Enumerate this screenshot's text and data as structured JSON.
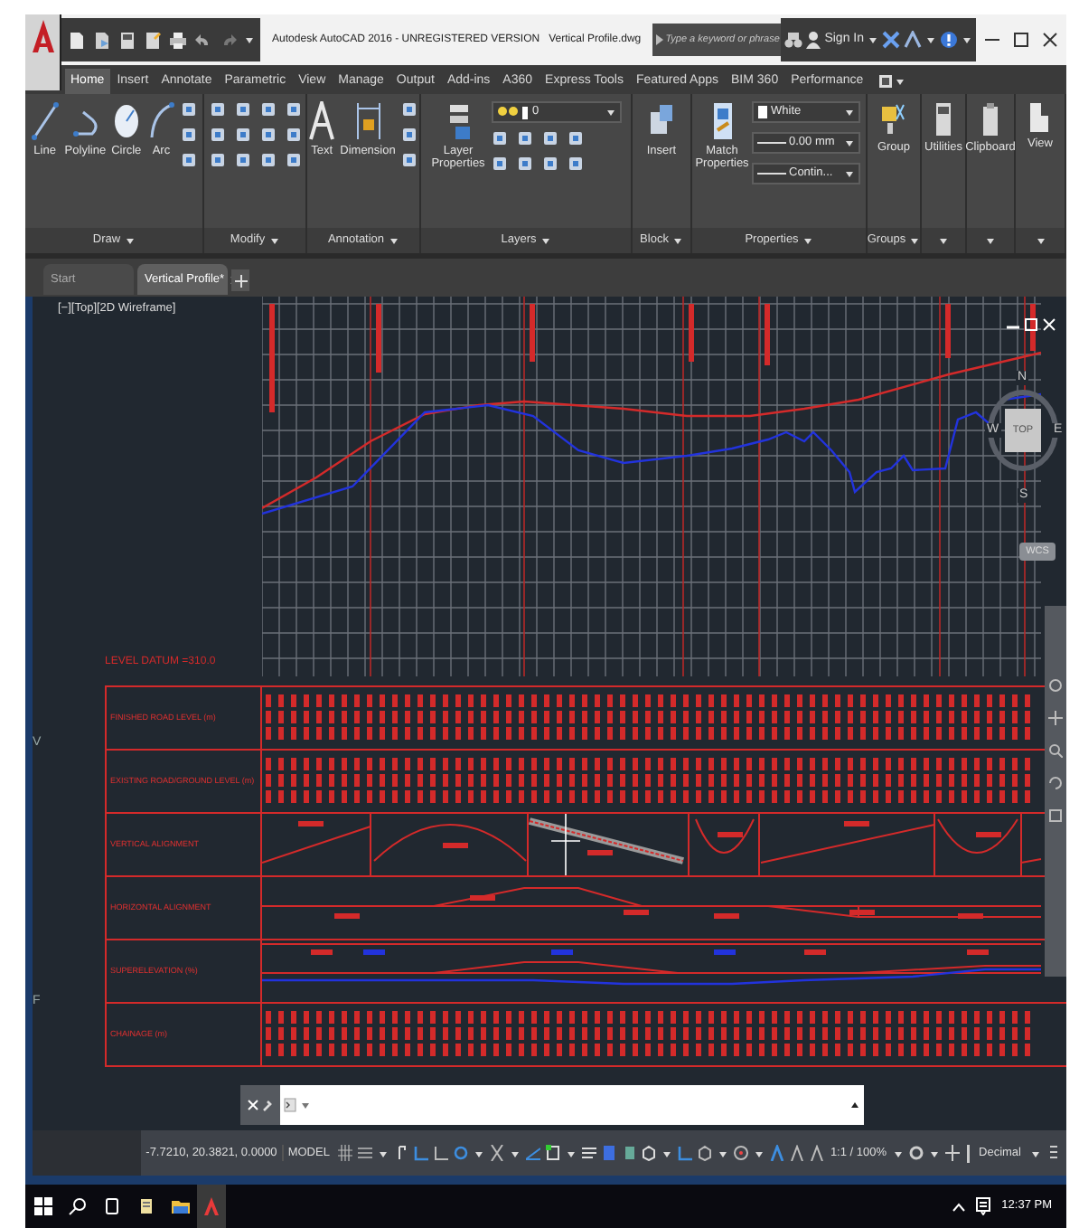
{
  "window": {
    "title": "Autodesk AutoCAD 2016 - UNREGISTERED VERSION",
    "file_name": "Vertical Profile.dwg"
  },
  "search": {
    "placeholder": "Type a keyword or phrase"
  },
  "sign_in": "Sign In",
  "ribbon_tabs": [
    {
      "label": "Home",
      "selected": true
    },
    {
      "label": "Insert",
      "selected": false
    },
    {
      "label": "Annotate",
      "selected": false
    },
    {
      "label": "Parametric",
      "selected": false
    },
    {
      "label": "View",
      "selected": false
    },
    {
      "label": "Manage",
      "selected": false
    },
    {
      "label": "Output",
      "selected": false
    },
    {
      "label": "Add-ins",
      "selected": false
    },
    {
      "label": "A360",
      "selected": false
    },
    {
      "label": "Express Tools",
      "selected": false
    },
    {
      "label": "Featured Apps",
      "selected": false
    },
    {
      "label": "BIM 360",
      "selected": false
    },
    {
      "label": "Performance",
      "selected": false
    }
  ],
  "ribbon_panels": [
    {
      "kind": "draw",
      "title": "Draw",
      "tools": [
        "Line",
        "Polyline",
        "Circle",
        "Arc"
      ]
    },
    {
      "kind": "modify",
      "title": "Modify"
    },
    {
      "kind": "annotation",
      "title": "Annotation",
      "tools": [
        "Text",
        "Dimension"
      ]
    },
    {
      "kind": "layers",
      "title": "Layers",
      "tools": [
        "Layer Properties"
      ],
      "layer": "0"
    },
    {
      "kind": "block",
      "title": "Block",
      "tools": [
        "Insert"
      ]
    },
    {
      "kind": "properties",
      "title": "Properties",
      "tools": [
        "Match Properties"
      ],
      "color_name": "White",
      "lineweight": "0.00 mm",
      "linetype": "Contin..."
    },
    {
      "kind": "groups",
      "title": "Groups",
      "tools": [
        "Group"
      ]
    },
    {
      "kind": "utilities",
      "tools": [
        "Utilities"
      ]
    },
    {
      "kind": "clipboard",
      "tools": [
        "Clipboard"
      ]
    },
    {
      "kind": "view",
      "tools": [
        "View"
      ]
    }
  ],
  "doc_tabs": [
    {
      "label": "Start",
      "selected": false
    },
    {
      "label": "Vertical Profile*",
      "selected": true
    }
  ],
  "viewport": {
    "label": "[−][Top][2D Wireframe]"
  },
  "viewcube": {
    "north": "N",
    "south": "S",
    "east": "E",
    "west": "W",
    "face": "TOP",
    "ucs": "WCS"
  },
  "edge_letters": [
    "V",
    "F"
  ],
  "profile": {
    "datum": "LEVEL DATUM =310.0",
    "rows": [
      {
        "kind": "numbers",
        "label": "FINISHED ROAD LEVEL (m)"
      },
      {
        "kind": "numbers",
        "label": "EXISTING ROAD/GROUND LEVEL (m)"
      },
      {
        "kind": "vertical",
        "label": "VERTICAL ALIGNMENT"
      },
      {
        "kind": "horizontal",
        "label": "HORIZONTAL ALIGNMENT"
      },
      {
        "kind": "superelevation",
        "label": "SUPERELEVATION (%)"
      },
      {
        "kind": "numbers",
        "label": "CHAINAGE (m)"
      }
    ]
  },
  "status_bar": {
    "coordinates": "-7.7210, 20.3821, 0.0000",
    "space": "MODEL",
    "annotation_scale": "1:1 / 100%",
    "units": "Decimal"
  },
  "taskbar": {
    "time": "12:37 PM"
  }
}
